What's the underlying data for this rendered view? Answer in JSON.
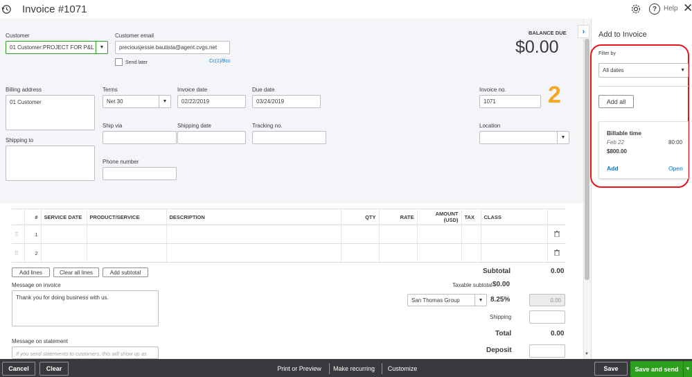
{
  "header": {
    "title": "Invoice #1071",
    "help_label": "Help",
    "step_number": "2"
  },
  "customer": {
    "label": "Customer",
    "value": "01 Customer:PROJECT FOR P&L"
  },
  "email": {
    "label": "Customer email",
    "value": "preciousjessie.bautista@agent.cvgs.net",
    "send_later_label": "Send later",
    "cc_bcc_label": "Cc(1)/Bcc"
  },
  "balance": {
    "label": "BALANCE DUE",
    "amount": "$0.00"
  },
  "billing": {
    "label": "Billing address",
    "value": "01 Customer"
  },
  "shipping_to": {
    "label": "Shipping to",
    "value": ""
  },
  "terms": {
    "label": "Terms",
    "value": "Net 30"
  },
  "invoice_date": {
    "label": "Invoice date",
    "value": "02/22/2019"
  },
  "due_date": {
    "label": "Due date",
    "value": "03/24/2019"
  },
  "invoice_no": {
    "label": "Invoice no.",
    "value": "1071"
  },
  "ship_via": {
    "label": "Ship via",
    "value": ""
  },
  "shipping_date": {
    "label": "Shipping date",
    "value": ""
  },
  "tracking_no": {
    "label": "Tracking no.",
    "value": ""
  },
  "location": {
    "label": "Location",
    "value": ""
  },
  "phone": {
    "label": "Phone number",
    "value": ""
  },
  "table": {
    "columns": [
      "#",
      "SERVICE DATE",
      "PRODUCT/SERVICE",
      "DESCRIPTION",
      "QTY",
      "RATE",
      "AMOUNT (USD)",
      "TAX",
      "CLASS"
    ],
    "rows": [
      {
        "num": "1"
      },
      {
        "num": "2"
      }
    ]
  },
  "line_buttons": {
    "add_lines": "Add lines",
    "clear_all_lines": "Clear all lines",
    "add_subtotal": "Add subtotal"
  },
  "message_invoice": {
    "label": "Message on invoice",
    "value": "Thank you for doing business with us."
  },
  "message_statement": {
    "label": "Message on statement",
    "placeholder": "If you send statements to customers, this will show up as"
  },
  "totals": {
    "subtotal_label": "Subtotal",
    "subtotal_value": "0.00",
    "taxable_label": "Taxable subtotal",
    "taxable_value": "$0.00",
    "tax_group": "San Thomas Group",
    "tax_rate": "8.25%",
    "tax_value": "0.00",
    "shipping_label": "Shipping",
    "total_label": "Total",
    "total_value": "0.00",
    "deposit_label": "Deposit"
  },
  "sidebar": {
    "title": "Add to Invoice",
    "filter_label": "Filter by",
    "filter_value": "All dates",
    "add_all": "Add all",
    "card": {
      "title": "Billable time",
      "date": "Feb 22",
      "hours": "80:00",
      "amount": "$800.00",
      "add": "Add",
      "open": "Open"
    }
  },
  "footer": {
    "cancel": "Cancel",
    "clear": "Clear",
    "print_preview": "Print or Preview",
    "make_recurring": "Make recurring",
    "customize": "Customize",
    "save": "Save",
    "save_send": "Save and send"
  },
  "colors": {
    "green": "#2ca01c",
    "footer_bg": "#393a3d",
    "link_blue": "#0077c5",
    "annotation_red": "#e8141b",
    "step_orange": "#f5a623"
  }
}
